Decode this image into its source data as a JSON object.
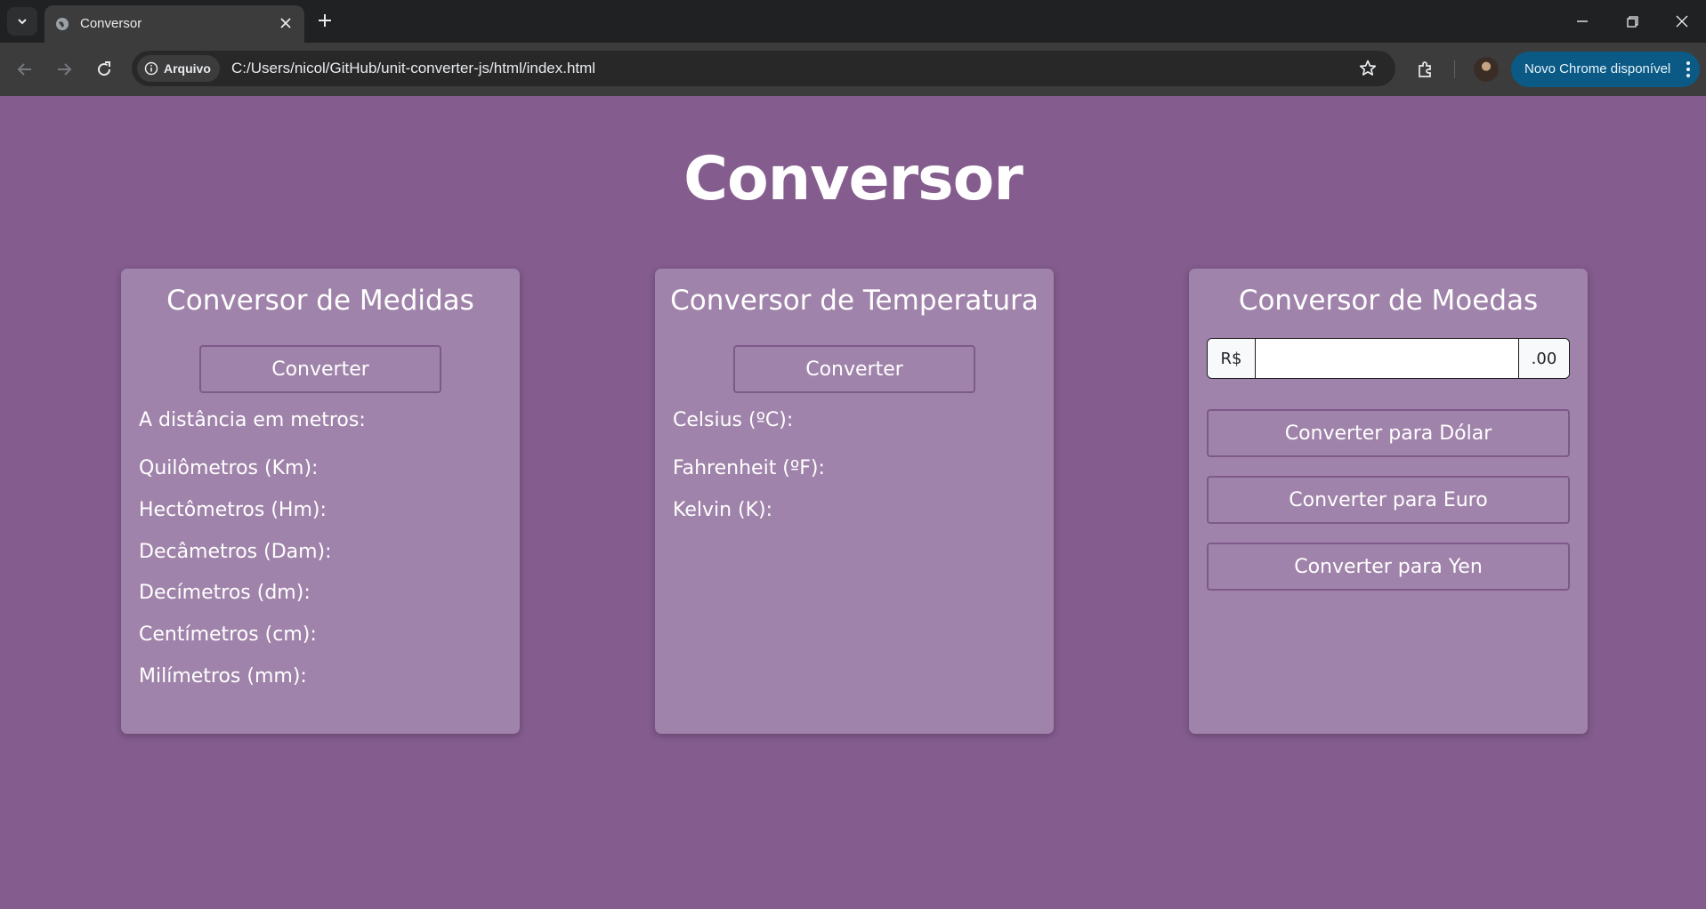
{
  "browser": {
    "tab_title": "Conversor",
    "site_chip_label": "Arquivo",
    "url": "C:/Users/nicol/GitHub/unit-converter-js/html/index.html",
    "update_label": "Novo Chrome disponível",
    "colors": {
      "tabbar": "#1f2122",
      "toolbar": "#3c3c3c",
      "update_chip": "#0b5a86"
    }
  },
  "page": {
    "title": "Conversor",
    "background": "#845d8e",
    "card_color": "#a083aa"
  },
  "medidas": {
    "title": "Conversor de Medidas",
    "button": "Converter",
    "intro": "A distância em metros:",
    "lines": [
      "Quilômetros (Km):",
      "Hectômetros (Hm):",
      "Decâmetros (Dam):",
      "Decímetros (dm):",
      "Centímetros (cm):",
      "Milímetros (mm):"
    ]
  },
  "temperatura": {
    "title": "Conversor de Temperatura",
    "button": "Converter",
    "lines": [
      "Celsius (ºC):",
      "Fahrenheit (ºF):",
      "Kelvin (K):"
    ]
  },
  "moedas": {
    "title": "Conversor de Moedas",
    "prefix": "R$",
    "suffix": ".00",
    "input_value": "",
    "buttons": [
      "Converter para Dólar",
      "Converter para Euro",
      "Converter para Yen"
    ]
  }
}
